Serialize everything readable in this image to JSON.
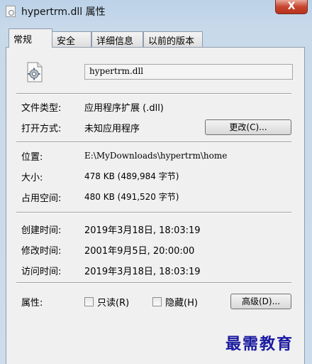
{
  "window": {
    "title": "hypertrm.dll 属性",
    "close_glyph": "X"
  },
  "tabs": [
    {
      "label": "常规",
      "active": true
    },
    {
      "label": "安全",
      "active": false
    },
    {
      "label": "详细信息",
      "active": false
    },
    {
      "label": "以前的版本",
      "active": false
    }
  ],
  "general": {
    "file_name": "hypertrm.dll",
    "type_label": "文件类型:",
    "type_value": "应用程序扩展 (.dll)",
    "opens_with_label": "打开方式:",
    "opens_with_value": "未知应用程序",
    "change_button": "更改(C)...",
    "location_label": "位置:",
    "location_value": "E:\\MyDownloads\\hypertrm\\home",
    "size_label": "大小:",
    "size_value": "478 KB (489,984 字节)",
    "size_on_disk_label": "占用空间:",
    "size_on_disk_value": "480 KB (491,520 字节)",
    "created_label": "创建时间:",
    "created_value": "2019年3月18日, 18:03:19",
    "modified_label": "修改时间:",
    "modified_value": "2001年9月5日, 20:00:00",
    "accessed_label": "访问时间:",
    "accessed_value": "2019年3月18日, 18:03:19",
    "attributes_label": "属性:",
    "readonly_label": "只读(R)",
    "hidden_label": "隐藏(H)",
    "advanced_button": "高级(D)..."
  },
  "watermark": "最需教育",
  "icons": {
    "title": "dll-file-icon",
    "file": "gear-document-icon"
  }
}
